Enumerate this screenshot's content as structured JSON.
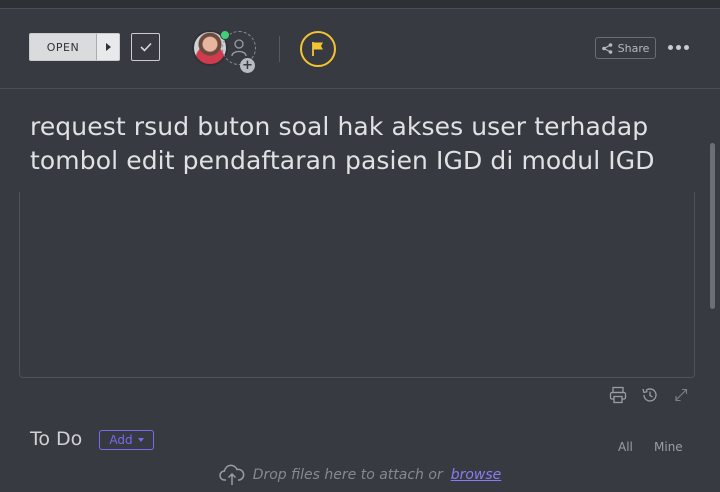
{
  "header": {
    "status_label": "OPEN",
    "share_label": "Share",
    "flag_color": "#f4c431"
  },
  "task": {
    "title": "request rsud buton soal hak akses user terhadap tombol edit pendaftaran pasien IGD di modul IGD"
  },
  "todo": {
    "title": "To Do",
    "add_label": "Add",
    "filters": [
      "All",
      "Mine"
    ]
  },
  "dropzone": {
    "text": "Drop files here to attach or",
    "link": "browse"
  },
  "colors": {
    "accent": "#7b68ee",
    "online": "#3fd17a",
    "background": "#373b41"
  }
}
